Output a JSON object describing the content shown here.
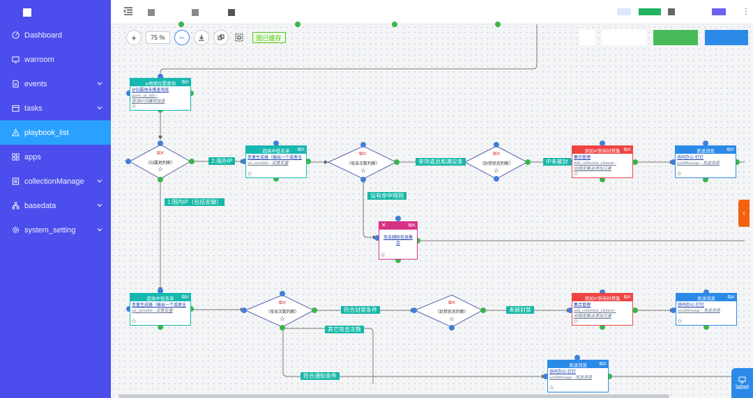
{
  "sidebar": {
    "items": [
      {
        "label": "Dashboard",
        "icon": "dashboard-icon"
      },
      {
        "label": "warroom",
        "icon": "monitor-icon"
      },
      {
        "label": "events",
        "icon": "file-icon"
      },
      {
        "label": "tasks",
        "icon": "calendar-icon"
      },
      {
        "label": "playbook_list",
        "icon": "triangle-icon"
      },
      {
        "label": "apps",
        "icon": "apps-icon"
      },
      {
        "label": "collectionManage",
        "icon": "collection-icon"
      },
      {
        "label": "basedata",
        "icon": "tree-icon"
      },
      {
        "label": "system_setting",
        "icon": "gear-icon"
      }
    ],
    "active": "playbook_list"
  },
  "toolbar": {
    "zoom": "75 %",
    "cache_tag": "图已缓存"
  },
  "nodes": {
    "ip_geo": {
      "title": "ip地理位置查询",
      "line1": "IP归属地未推查询库",
      "line2": "query_ip_info -",
      "line3": "查询IP归属地信息"
    },
    "overseas_risk": {
      "title": "超高中低名单",
      "line1": "变量生成器（输出一个或者全",
      "line2": "set_variable - 设置变量"
    },
    "add_ip_block_1": {
      "title": "添加IP到待封禁集",
      "line1": "集合管理",
      "line2": "add_collection_element -",
      "line3": "向限定集合添加元素"
    },
    "send_msg_1": {
      "title": "发送消息",
      "line1": "协同办公-钉钉",
      "line2": "sendMessage - 发送消息"
    },
    "attack_info": {
      "title": "",
      "line1": "攻击辅助信息聚",
      "line2": "合"
    },
    "domestic_risk": {
      "title": "超高中低名单",
      "line1": "变量生成器（输出一个或者全",
      "line2": "set_variable - 设置变量"
    },
    "add_ip_block_2": {
      "title": "添加IP到待封禁集",
      "line1": "集合管理",
      "line2": "add_collection_element -",
      "line3": "向限定集合添加元素"
    },
    "send_msg_2": {
      "title": "发送消息",
      "line1": "协同办公-钉钉",
      "line2": "sendMessage - 发送消息"
    },
    "send_msg_3": {
      "title": "发送消息",
      "line1": "协同办公-钉钉",
      "line2": "sendMessage - 发送消息"
    }
  },
  "decisions": {
    "geo_judge": "（归属地判断）",
    "attack_count_1": "（攻击次数判断）",
    "block_state_1": "（封禁状态判断）",
    "attack_count_2": "（攻击次数判断）",
    "block_state_2": "（封禁状态判断）"
  },
  "edge_labels": {
    "overseas": "2:海外IP",
    "single_match": "单项或总和满足条",
    "ip_not_blocked": "IP未被封",
    "no_rule_hit": "没有命中规则",
    "domestic": "1:国内IP（包括安徽）",
    "meets_block": "符合封禁条件",
    "not_blocked": "未被封禁",
    "other_count": "其它攻击次数",
    "meets_notify": "符合通知条件"
  },
  "label_button": "label",
  "colors": {
    "sidebar_bg": "#4b4dec",
    "active_item": "#2aa1ff",
    "teal": "#16b8b0",
    "red": "#ef4444",
    "blue": "#2b8ae8",
    "pink": "#d63384",
    "port_green": "#3bb54a",
    "port_blue": "#3f7fd8"
  }
}
